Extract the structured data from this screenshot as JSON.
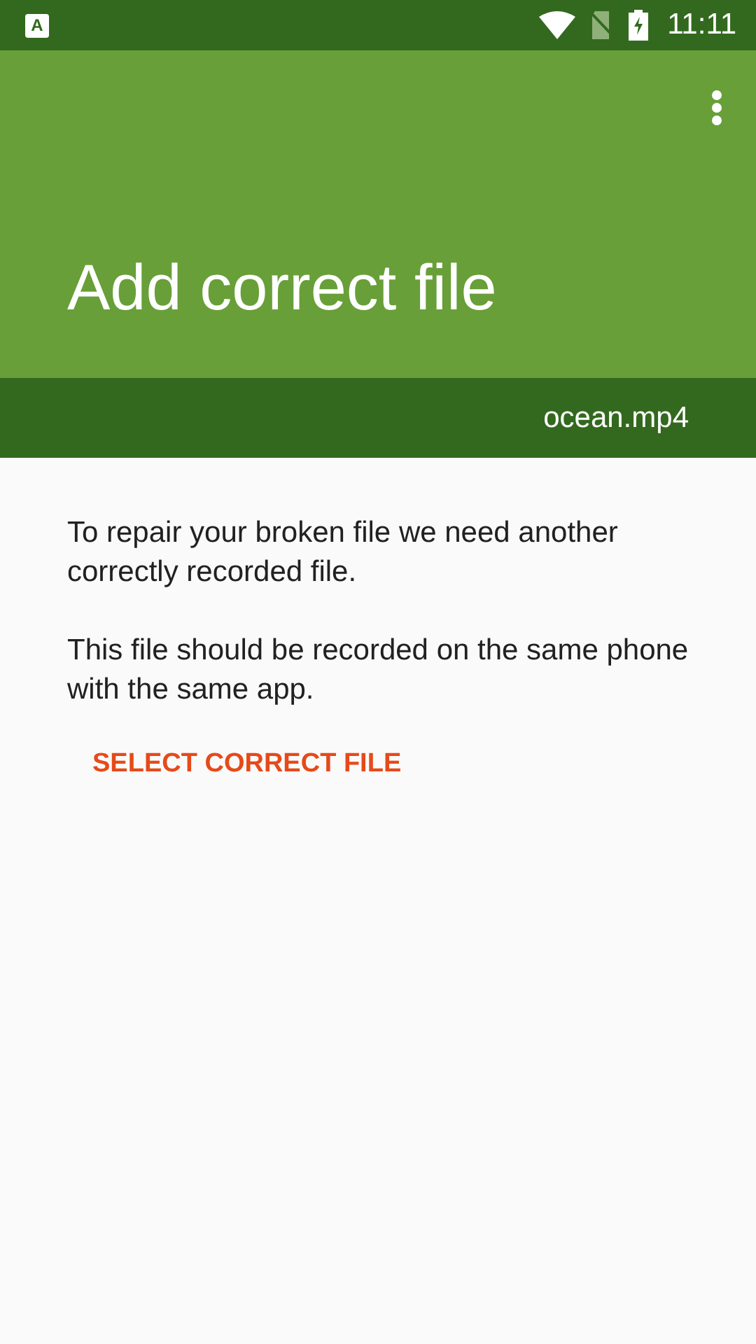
{
  "status_bar": {
    "notification_icon": "A",
    "time": "11:11"
  },
  "app_bar": {
    "title": "Add correct file"
  },
  "file_bar": {
    "file_name": "ocean.mp4"
  },
  "body": {
    "paragraphs": [
      "To repair your broken file we need another correctly recorded file.",
      "This file should be recorded on the same phone with the same app."
    ],
    "button": "SELECT CORRECT FILE"
  }
}
